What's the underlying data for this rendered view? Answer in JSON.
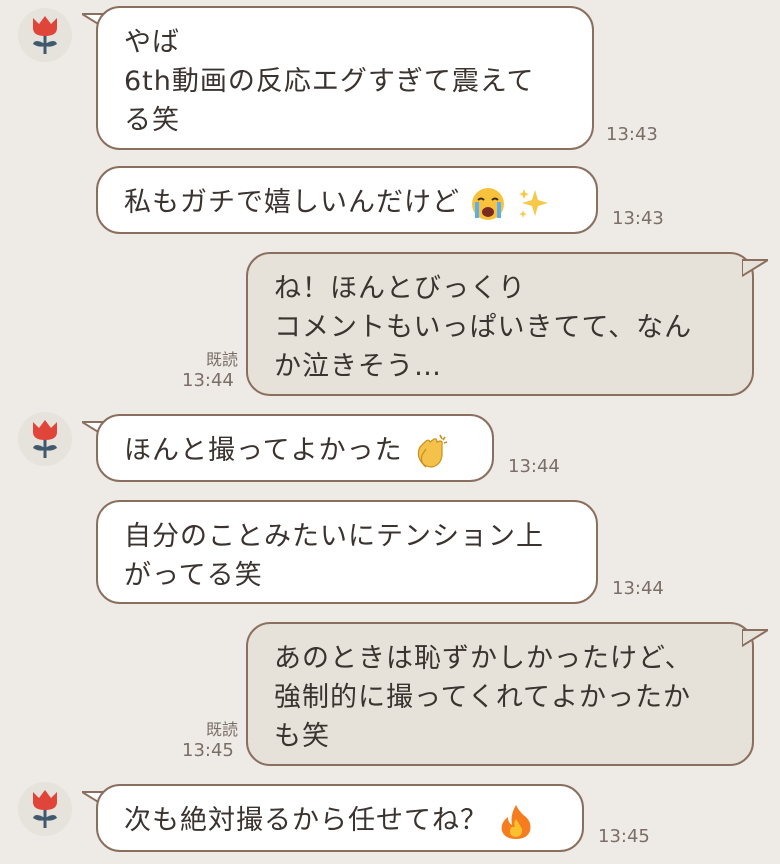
{
  "messages": [
    {
      "id": "m1",
      "side": "in",
      "lines": [
        "やば",
        "6th動画の反応エグすぎて震えて",
        "る笑"
      ],
      "time": "13:43"
    },
    {
      "id": "m2",
      "side": "in",
      "lines": [
        "私もガチで嬉しいんだけど"
      ],
      "emojis": [
        "loudly-crying-face",
        "sparkles"
      ],
      "time": "13:43"
    },
    {
      "id": "m3",
      "side": "out",
      "lines": [
        "ね！ほんとびっくり",
        "コメントもいっぱいきてて、なん",
        "か泣きそう…"
      ],
      "read": "既読",
      "time": "13:44"
    },
    {
      "id": "m4",
      "side": "in",
      "lines": [
        "ほんと撮ってよかった"
      ],
      "emojis": [
        "clapping-hands"
      ],
      "time": "13:44"
    },
    {
      "id": "m5",
      "side": "in",
      "lines": [
        "自分のことみたいにテンション上",
        "がってる笑"
      ],
      "time": "13:44"
    },
    {
      "id": "m6",
      "side": "out",
      "lines": [
        "あのときは恥ずかしかったけど、",
        "強制的に撮ってくれてよかったか",
        "も笑"
      ],
      "read": "既読",
      "time": "13:45"
    },
    {
      "id": "m7",
      "side": "in",
      "lines": [
        "次も絶対撮るから任せてね？"
      ],
      "emojis": [
        "fire"
      ],
      "time": "13:45"
    }
  ],
  "colors": {
    "background": "#eeebe6",
    "incoming": "#ffffff",
    "outgoing": "#e7e2d9",
    "border": "#8a6f5e",
    "flower": "#e0453a",
    "stem": "#3f5a6d"
  }
}
